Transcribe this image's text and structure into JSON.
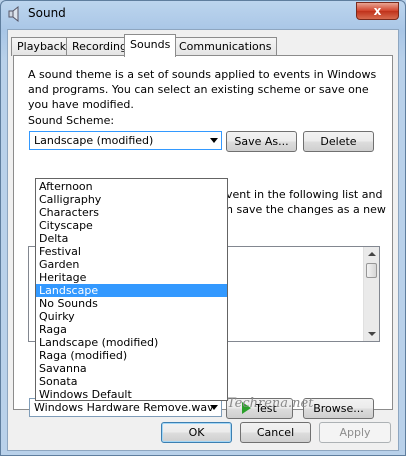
{
  "window": {
    "title": "Sound",
    "close_glyph": "x"
  },
  "tabs": [
    {
      "label": "Playback"
    },
    {
      "label": "Recording"
    },
    {
      "label": "Sounds"
    },
    {
      "label": "Communications"
    }
  ],
  "sounds_tab": {
    "description": "A sound theme is a set of sounds applied to events in Windows and programs.  You can select an existing scheme or save one you have modified.",
    "scheme_label": "Sound Scheme:",
    "scheme_value": "Landscape (modified)",
    "save_as_label": "Save As...",
    "delete_label": "Delete",
    "partial_text_1": "vent in the following list and",
    "partial_text_2": "n save the changes as a new",
    "sound_value": "Windows Hardware Remove.wav",
    "test_label": "Test",
    "browse_label": "Browse..."
  },
  "scheme_options": [
    "Afternoon",
    "Calligraphy",
    "Characters",
    "Cityscape",
    "Delta",
    "Festival",
    "Garden",
    "Heritage",
    "Landscape",
    "No Sounds",
    "Quirky",
    "Raga",
    "Landscape (modified)",
    "Raga (modified)",
    "Savanna",
    "Sonata",
    "Windows Default"
  ],
  "highlighted_option": "Landscape",
  "footer": {
    "ok_label": "OK",
    "cancel_label": "Cancel",
    "apply_label": "Apply"
  },
  "watermark": "Techrena.net",
  "colors": {
    "selection": "#3399ff",
    "play_icon": "#2aa02a",
    "close_button": "#d1422a"
  }
}
